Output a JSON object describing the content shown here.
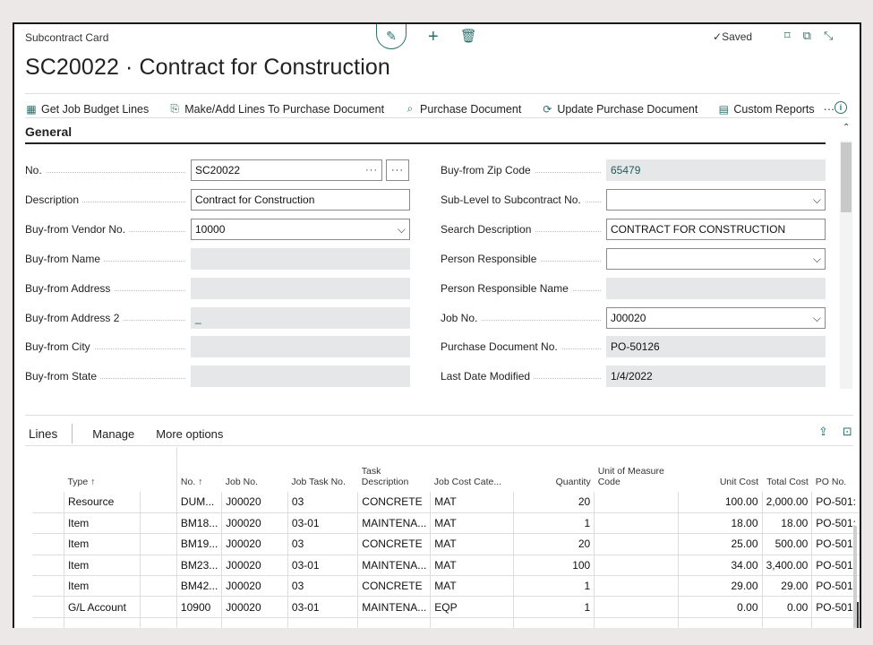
{
  "page": {
    "breadcrumb": "Subcontract Card",
    "title": "SC20022 · Contract for Construction",
    "status": "Saved",
    "icons": {
      "edit": "pencil-icon",
      "new": "plus-icon",
      "delete": "trash-icon",
      "saved": "check-icon",
      "bookmark": "bookmark-icon",
      "open_new": "open-in-new-window-icon",
      "collapse": "collapse-icon"
    }
  },
  "toolbar": {
    "items": [
      {
        "label": "Get Job Budget Lines",
        "icon": "budget-lines-icon"
      },
      {
        "label": "Make/Add Lines To Purchase Document",
        "icon": "make-lines-icon"
      },
      {
        "label": "Purchase Document",
        "icon": "document-search-icon"
      },
      {
        "label": "Update Purchase Document",
        "icon": "update-document-icon"
      },
      {
        "label": "Custom Reports",
        "icon": "report-icon"
      }
    ],
    "more": "···",
    "info_icon": "i"
  },
  "general": {
    "title": "General",
    "left": [
      {
        "label": "No.",
        "value": "SC20022",
        "type": "lookup"
      },
      {
        "label": "Description",
        "value": "Contract for Construction",
        "type": "text"
      },
      {
        "label": "Buy-from Vendor No.",
        "value": "10000",
        "type": "dropdown"
      },
      {
        "label": "Buy-from Name",
        "value": "",
        "type": "readonly"
      },
      {
        "label": "Buy-from Address",
        "value": "",
        "type": "readonly"
      },
      {
        "label": "Buy-from Address 2",
        "value": "_",
        "type": "readonly"
      },
      {
        "label": "Buy-from City",
        "value": "",
        "type": "readonly"
      },
      {
        "label": "Buy-from State",
        "value": "",
        "type": "readonly"
      }
    ],
    "right": [
      {
        "label": "Buy-from Zip Code",
        "value": "65479",
        "type": "readonly"
      },
      {
        "label": "Sub-Level to Subcontract No.",
        "value": "",
        "type": "dropdown"
      },
      {
        "label": "Search Description",
        "value": "CONTRACT FOR CONSTRUCTION",
        "type": "text"
      },
      {
        "label": "Person Responsible",
        "value": "",
        "type": "dropdown"
      },
      {
        "label": "Person Responsible Name",
        "value": "",
        "type": "readonly"
      },
      {
        "label": "Job No.",
        "value": "J00020",
        "type": "dropdown"
      },
      {
        "label": "Purchase Document No.",
        "value": "PO-50126",
        "type": "readonly"
      },
      {
        "label": "Last Date Modified",
        "value": "1/4/2022",
        "type": "readonly"
      }
    ]
  },
  "lines": {
    "title": "Lines",
    "actions": [
      "Manage",
      "More options"
    ],
    "columns": [
      "Type ↑",
      "No. ↑",
      "Job No.",
      "Job Task No.",
      "Task Description",
      "Job Cost Cate...",
      "Quantity",
      "Unit of Measure Code",
      "Unit Cost",
      "Total Cost",
      "PO No."
    ],
    "rows": [
      [
        "Resource",
        "DUM...",
        "J00020",
        "03",
        "CONCRETE",
        "MAT",
        "20",
        "",
        "100.00",
        "2,000.00",
        "PO-501:"
      ],
      [
        "Item",
        "BM18...",
        "J00020",
        "03-01",
        "MAINTENA...",
        "MAT",
        "1",
        "",
        "18.00",
        "18.00",
        "PO-501:"
      ],
      [
        "Item",
        "BM19...",
        "J00020",
        "03",
        "CONCRETE",
        "MAT",
        "20",
        "",
        "25.00",
        "500.00",
        "PO-501:"
      ],
      [
        "Item",
        "BM23...",
        "J00020",
        "03-01",
        "MAINTENA...",
        "MAT",
        "100",
        "",
        "34.00",
        "3,400.00",
        "PO-501:"
      ],
      [
        "Item",
        "BM42...",
        "J00020",
        "03",
        "CONCRETE",
        "MAT",
        "1",
        "",
        "29.00",
        "29.00",
        "PO-501:"
      ],
      [
        "G/L Account",
        "10900",
        "J00020",
        "03-01",
        "MAINTENA...",
        "EQP",
        "1",
        "",
        "0.00",
        "0.00",
        "PO-501:"
      ],
      [
        "",
        "",
        "",
        "",
        "",
        "",
        "",
        "",
        "",
        "",
        ""
      ]
    ]
  }
}
